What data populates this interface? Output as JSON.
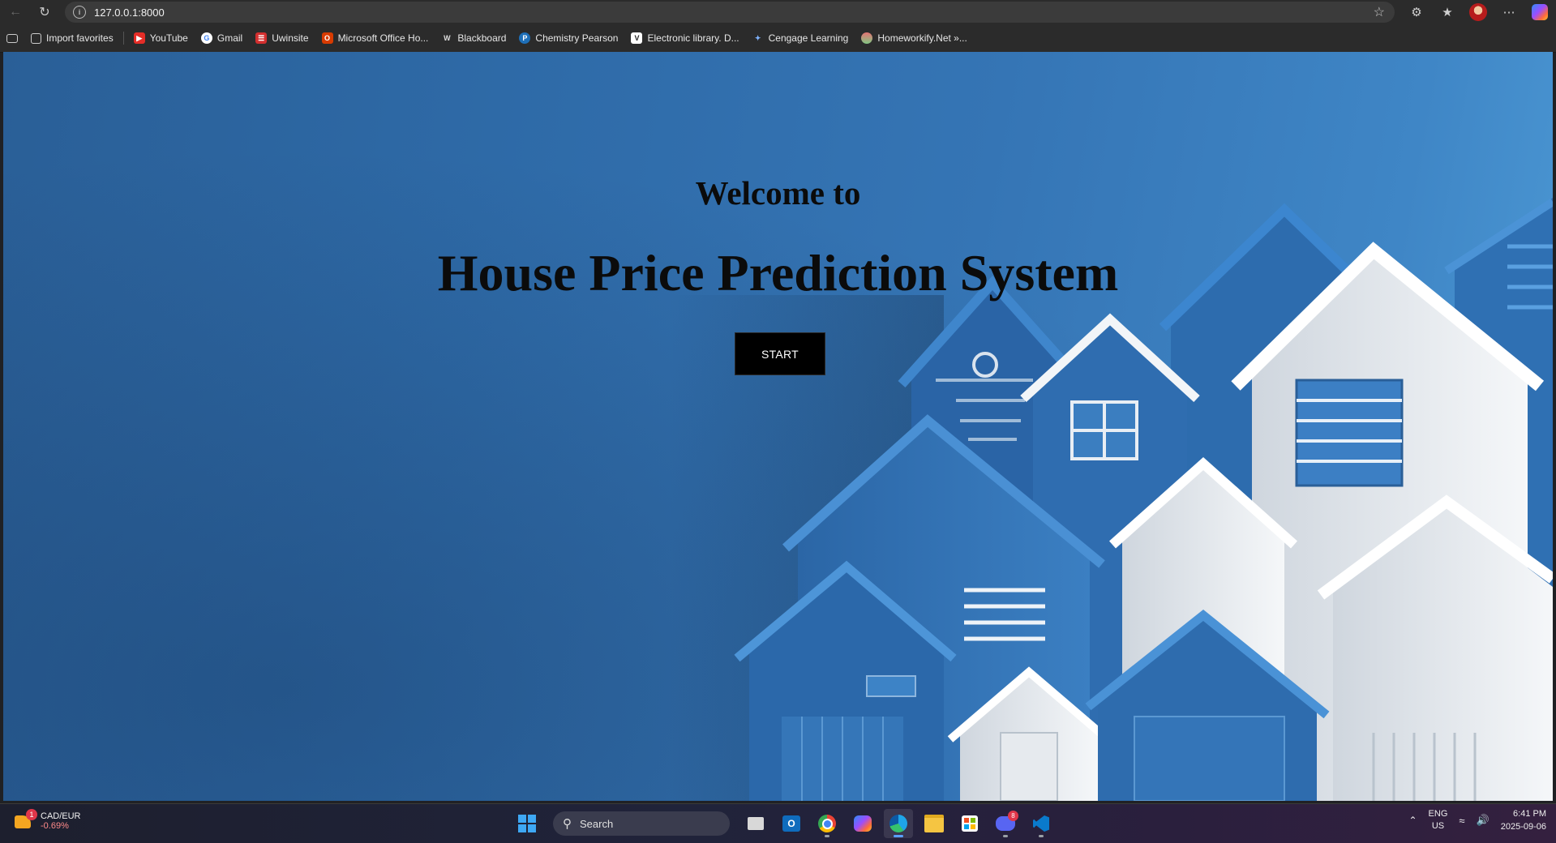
{
  "browser": {
    "url": "127.0.0.1:8000",
    "bookmarks": [
      {
        "label": "Import favorites",
        "icon": "import-favorites-icon"
      },
      {
        "label": "YouTube",
        "icon": "youtube-icon"
      },
      {
        "label": "Gmail",
        "icon": "gmail-icon"
      },
      {
        "label": "Uwinsite",
        "icon": "uwinsite-icon"
      },
      {
        "label": "Microsoft Office Ho...",
        "icon": "office-icon"
      },
      {
        "label": "Blackboard",
        "icon": "blackboard-icon"
      },
      {
        "label": "Chemistry Pearson",
        "icon": "pearson-icon"
      },
      {
        "label": "Electronic library. D...",
        "icon": "electronic-library-icon"
      },
      {
        "label": "Cengage Learning",
        "icon": "cengage-icon"
      },
      {
        "label": "Homeworkify.Net »...",
        "icon": "homeworkify-icon"
      }
    ]
  },
  "page": {
    "welcome": "Welcome to",
    "title": "House Price Prediction System",
    "start_label": "START"
  },
  "taskbar": {
    "widget_title": "CAD/EUR",
    "widget_value": "-0.69%",
    "widget_badge": "1",
    "search_label": "Search",
    "discord_badge": "8",
    "lang_line1": "ENG",
    "lang_line2": "US",
    "time": "6:41 PM",
    "date": "2025-09-06"
  },
  "colors": {
    "page_bg_left": "#2a5f97",
    "page_bg_right": "#4e9bd6",
    "button_bg": "#000000",
    "heading_text": "#0b0b0b"
  }
}
